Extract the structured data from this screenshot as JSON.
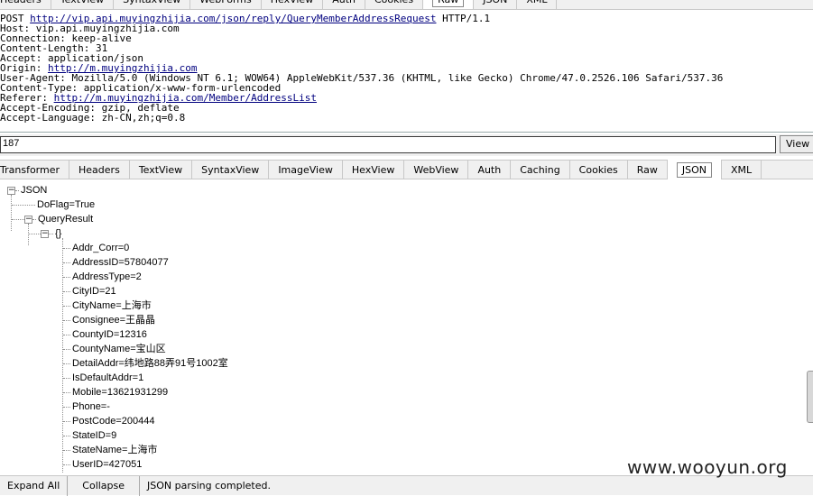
{
  "request_tabs": [
    "Headers",
    "TextView",
    "SyntaxView",
    "WebForms",
    "HexView",
    "Auth",
    "Cookies",
    "Raw",
    "JSON",
    "XML"
  ],
  "request_active_tab": "Raw",
  "raw_request": {
    "line1_method": "POST ",
    "line1_url": "http://vip.api.muyingzhijia.com/json/reply/QueryMemberAddressRequest",
    "line1_proto": " HTTP/1.1",
    "host": "Host: vip.api.muyingzhijia.com",
    "connection": "Connection: keep-alive",
    "content_length": "Content-Length: 31",
    "accept": "Accept: application/json",
    "origin_label": "Origin: ",
    "origin_url": "http://m.muyingzhijia.com",
    "user_agent": "User-Agent: Mozilla/5.0 (Windows NT 6.1; WOW64) AppleWebKit/537.36 (KHTML, like Gecko) Chrome/47.0.2526.106 Safari/537.36",
    "content_type": "Content-Type: application/x-www-form-urlencoded",
    "referer_label": "Referer: ",
    "referer_url": "http://m.muyingzhijia.com/Member/AddressList",
    "accept_encoding": "Accept-Encoding: gzip, deflate",
    "accept_language": "Accept-Language: zh-CN,zh;q=0.8"
  },
  "body_input": {
    "value": "187"
  },
  "view_button": "View i",
  "response_tabs": [
    "Transformer",
    "Headers",
    "TextView",
    "SyntaxView",
    "ImageView",
    "HexView",
    "WebView",
    "Auth",
    "Caching",
    "Cookies",
    "Raw",
    "JSON",
    "XML"
  ],
  "response_active_tab": "JSON",
  "tree": {
    "root": "JSON",
    "doflag": "DoFlag=True",
    "query_result": "QueryResult",
    "object": "{}",
    "fields": [
      "Addr_Corr=0",
      "AddressID=57804077",
      "AddressType=2",
      "CityID=21",
      "CityName=上海市",
      "Consignee=王晶晶",
      "CountyID=12316",
      "CountyName=宝山区",
      "DetailAddr=纬地路88弄91号1002室",
      "IsDefaultAddr=1",
      "Mobile=13621931299",
      "Phone=-",
      "PostCode=200444",
      "StateID=9",
      "StateName=上海市",
      "UserID=427051"
    ]
  },
  "status": {
    "expand_all": "Expand All",
    "collapse": "Collapse",
    "message": "JSON parsing completed."
  },
  "watermark": "www.wooyun.org"
}
